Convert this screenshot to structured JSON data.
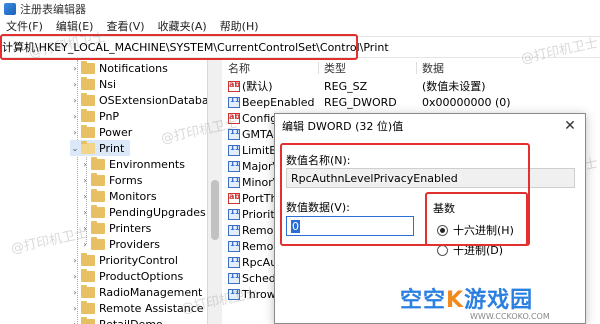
{
  "window": {
    "title": "注册表编辑器"
  },
  "menu": [
    "文件(F)",
    "编辑(E)",
    "查看(V)",
    "收藏夹(A)",
    "帮助(H)"
  ],
  "address": {
    "path": "计算机\\HKEY_LOCAL_MACHINE\\SYSTEM\\CurrentControlSet\\Control\\Print"
  },
  "tree": {
    "items": [
      {
        "label": "Notifications",
        "level": 1,
        "selected": false
      },
      {
        "label": "Nsi",
        "level": 1,
        "selected": false
      },
      {
        "label": "OSExtensionDatabase",
        "level": 1,
        "selected": false
      },
      {
        "label": "PnP",
        "level": 1,
        "selected": false
      },
      {
        "label": "Power",
        "level": 1,
        "selected": false
      },
      {
        "label": "Print",
        "level": 1,
        "selected": true,
        "expanded": true
      },
      {
        "label": "Environments",
        "level": 2,
        "selected": false
      },
      {
        "label": "Forms",
        "level": 2,
        "selected": false
      },
      {
        "label": "Monitors",
        "level": 2,
        "selected": false
      },
      {
        "label": "PendingUpgrades",
        "level": 2,
        "selected": false
      },
      {
        "label": "Printers",
        "level": 2,
        "selected": false
      },
      {
        "label": "Providers",
        "level": 2,
        "selected": false
      },
      {
        "label": "PriorityControl",
        "level": 1,
        "selected": false
      },
      {
        "label": "ProductOptions",
        "level": 1,
        "selected": false
      },
      {
        "label": "RadioManagement",
        "level": 1,
        "selected": false
      },
      {
        "label": "Remote Assistance",
        "level": 1,
        "selected": false
      },
      {
        "label": "RetailDemo",
        "level": 1,
        "selected": false
      }
    ]
  },
  "list": {
    "headers": {
      "name": "名称",
      "type": "类型",
      "data": "数据"
    },
    "rows": [
      {
        "icon": "string-value-icon",
        "name": "(默认)",
        "type": "REG_SZ",
        "data": "(数值未设置)"
      },
      {
        "icon": "dword-value-icon",
        "name": "BeepEnabled",
        "type": "REG_DWORD",
        "data": "0x00000000 (0)"
      },
      {
        "icon": "string-value-icon",
        "name": "Configl",
        "type": "",
        "data": ""
      },
      {
        "icon": "dword-value-icon",
        "name": "GMTAc",
        "type": "",
        "data": ""
      },
      {
        "icon": "dword-value-icon",
        "name": "LimitBl",
        "type": "",
        "data": ""
      },
      {
        "icon": "dword-value-icon",
        "name": "MajorV",
        "type": "",
        "data": ""
      },
      {
        "icon": "dword-value-icon",
        "name": "MinorV",
        "type": "",
        "data": ""
      },
      {
        "icon": "string-value-icon",
        "name": "PortThr",
        "type": "",
        "data": ""
      },
      {
        "icon": "dword-value-icon",
        "name": "Priority",
        "type": "",
        "data": ""
      },
      {
        "icon": "dword-value-icon",
        "name": "Remov",
        "type": "",
        "data": ""
      },
      {
        "icon": "dword-value-icon",
        "name": "Remov",
        "type": "",
        "data": ""
      },
      {
        "icon": "dword-value-icon",
        "name": "RpcAut",
        "type": "",
        "data": ""
      },
      {
        "icon": "dword-value-icon",
        "name": "Schedu",
        "type": "",
        "data": ""
      },
      {
        "icon": "dword-value-icon",
        "name": "ThrowD",
        "type": "",
        "data": ""
      }
    ]
  },
  "dialog": {
    "title": "编辑 DWORD (32 位)值",
    "close": "✕",
    "name_label": "数值名称(N):",
    "name_value": "RpcAuthnLevelPrivacyEnabled",
    "data_label": "数值数据(V):",
    "data_value": "0",
    "base_label": "基数",
    "base_options": [
      {
        "label": "十六进制(H)",
        "checked": true
      },
      {
        "label": "十进制(D)",
        "checked": false
      }
    ]
  },
  "watermarks": [
    "@打印机卫士",
    "@打印机卫士",
    "@打印机卫士",
    "@打印机卫士",
    "@打印机卫士",
    "@打印机卫士"
  ],
  "brand": {
    "left": "空空",
    "k": "K",
    "right": "游戏园",
    "url": "WWW.CCKOKO.COM"
  }
}
